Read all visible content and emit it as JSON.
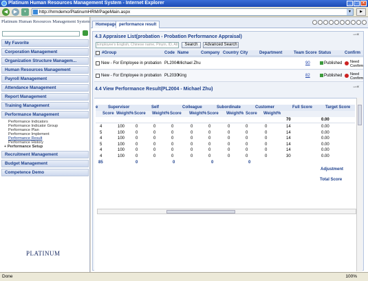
{
  "window": {
    "title": "Platinum Human Resources Management System - Internet Explorer"
  },
  "address": {
    "url": "http://hrmdemo/PlatinumHRM/PageMain.aspx"
  },
  "sidebar": {
    "system_title": "Platinum Human Resources Management System",
    "menu": [
      "My Favorite",
      "Corporation Management",
      "Organization Structure Managem...",
      "Human Resources Management",
      "Payroll Management",
      "Attendance Management",
      "Report Management",
      "Training Management",
      "Performance Management"
    ],
    "performance_sub": [
      "Performance Indicators",
      "Performance Indicator Group",
      "Performance Plan",
      "Performance Implement",
      "Performance Result",
      "Performance History",
      "+ Performance Setup"
    ],
    "menu_bottom": [
      "Recruitment Management",
      "Budget Management",
      "Competence Demo"
    ],
    "logo_text": "PLATINUM"
  },
  "tabs": {
    "homepage": "Homepage",
    "performance_result": "performance result"
  },
  "appraisee": {
    "title": "4.3 Appraisee List(probation - Probation Performance Appraisal)",
    "search_placeholder": "Employee's English, Chinese name, Pinyin, ID, All",
    "search_label": "Search",
    "advanced_label": "Advanced Search",
    "columns": [
      "#Group",
      "Code",
      "Name",
      "Company",
      "Country",
      "City",
      "Department",
      "Team Score",
      "Status",
      "Confirm"
    ],
    "rows": [
      {
        "group": "New - For Employee in probation",
        "code": "PL2004",
        "name": "Michael Zhu",
        "score": "90",
        "status": "Published",
        "confirm": "Need Confirm"
      },
      {
        "group": "New - For Employee in probation",
        "code": "PL2030",
        "name": "King",
        "score": "82",
        "status": "Published",
        "confirm": "Need Confirm"
      }
    ]
  },
  "result": {
    "title": "4.4 View Performance Result(PL2004 - Michael Zhu)",
    "group_headers": [
      "e",
      "Supervisor",
      "Self",
      "Colleague",
      "Subordinate",
      "Customer",
      "Full Score",
      "Target Score"
    ],
    "sub_headers": [
      "Score",
      "Weight%",
      "Score",
      "Weight%",
      "Score",
      "Weight%",
      "Score",
      "Weight%",
      "Score",
      "Weight%"
    ],
    "totals": {
      "full": "70",
      "target": "0.00"
    },
    "rows": [
      [
        "4",
        "100",
        "0",
        "0",
        "0",
        "0",
        "0",
        "0",
        "0",
        "0",
        "14",
        "0.00"
      ],
      [
        "5",
        "100",
        "0",
        "0",
        "0",
        "0",
        "0",
        "0",
        "0",
        "0",
        "14",
        "0.00"
      ],
      [
        "4",
        "100",
        "0",
        "0",
        "0",
        "0",
        "0",
        "0",
        "0",
        "0",
        "14",
        "0.00"
      ],
      [
        "5",
        "100",
        "0",
        "0",
        "0",
        "0",
        "0",
        "0",
        "0",
        "0",
        "14",
        "0.00"
      ],
      [
        "4",
        "100",
        "0",
        "0",
        "0",
        "0",
        "0",
        "0",
        "0",
        "0",
        "14",
        "0.00"
      ],
      [
        "4",
        "100",
        "0",
        "0",
        "0",
        "0",
        "0",
        "0",
        "0",
        "0",
        "30",
        "0.00"
      ]
    ],
    "summary": [
      "85",
      "0",
      "0",
      "0",
      "0"
    ],
    "adjustment_label": "Adjustment",
    "total_label": "Total Score"
  },
  "status": {
    "text": "Done",
    "zoom": "100%"
  }
}
